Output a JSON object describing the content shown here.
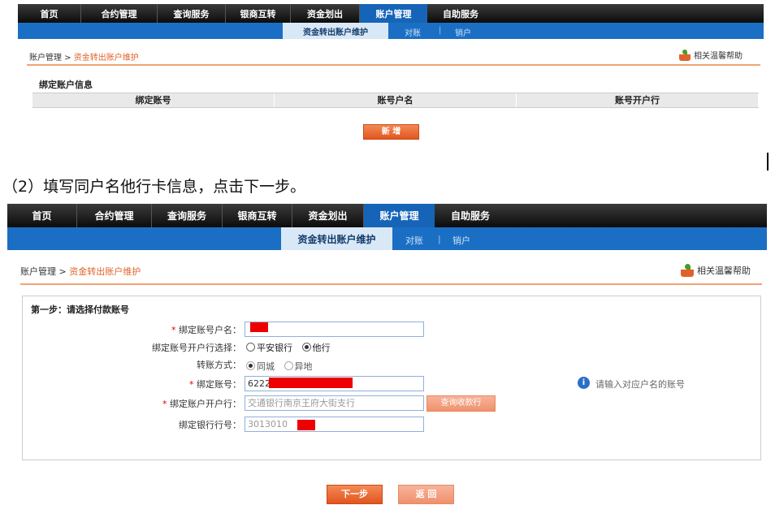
{
  "nav_items": [
    "首页",
    "合约管理",
    "查询服务",
    "银商互转",
    "资金划出",
    "账户管理",
    "自助服务"
  ],
  "nav_active": "账户管理",
  "subnav": {
    "current": "资金转出账户维护",
    "link1": "对账",
    "sep": "|",
    "link2": "销户"
  },
  "breadcrumb": {
    "root": "账户管理 >",
    "current": "资金转出账户维护"
  },
  "help_label": "相关温馨帮助",
  "screen1": {
    "section_title": "绑定账户信息",
    "columns": [
      "绑定账号",
      "账号户名",
      "账号开户行"
    ],
    "add_button": "新 增"
  },
  "instruction": "（2）填写同户名他行卡信息，点击下一步。",
  "screen2": {
    "step_title": "第一步：请选择付款账号",
    "fields": {
      "account_name_label": "绑定账号户名：",
      "bank_select_label": "绑定账号开户行选择：",
      "bank_option_pingan": "平安银行",
      "bank_option_other": "他行",
      "transfer_mode_label": "转账方式：",
      "mode_same_city": "同城",
      "mode_other_city": "异地",
      "account_no_label": "绑定账号：",
      "account_no_value": "6222",
      "open_bank_label": "绑定账户开户行：",
      "open_bank_value": "交通银行南京王府大街支行",
      "bank_code_label": "绑定银行行号：",
      "bank_code_value": "3013010",
      "query_bank_button": "查询收款行"
    },
    "hint": "请输入对应户名的账号",
    "next_button": "下一步",
    "back_button": "返 回"
  },
  "colors": {
    "accent": "#1664b8",
    "orange": "#e2551f"
  }
}
